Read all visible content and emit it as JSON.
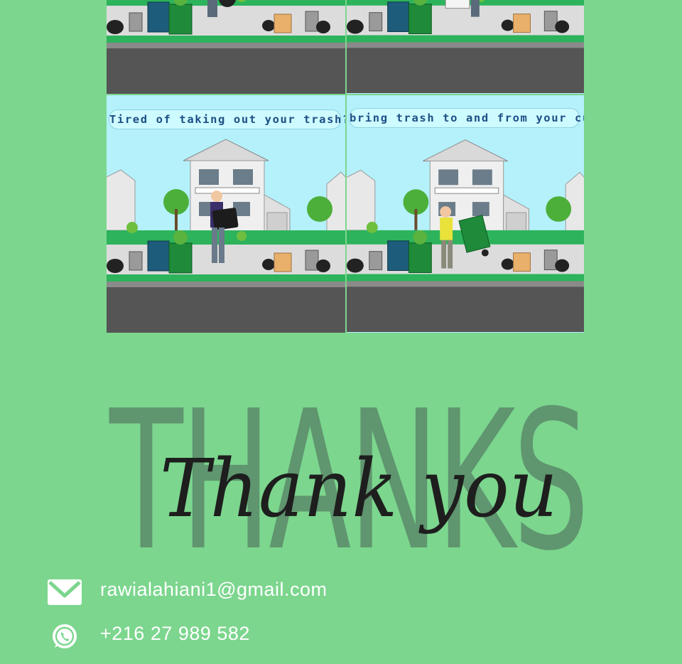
{
  "panels": [
    {
      "caption": "",
      "scene": "delivery"
    },
    {
      "caption": "",
      "scene": "pickup"
    },
    {
      "caption": "Tired of taking out your trash?",
      "scene": "tv-carry"
    },
    {
      "caption": "bring trash to and from your curb",
      "scene": "bin-push"
    }
  ],
  "thanks": {
    "background_word": "THANKS",
    "script_text": "Thank you"
  },
  "contact": {
    "email": "rawialahiani1@gmail.com",
    "phone": "+216 27 989 582",
    "email_icon": "envelope-icon",
    "phone_icon": "whatsapp-icon"
  },
  "colors": {
    "background": "#7cd68e",
    "sky": "#b4f1fb",
    "road": "#555555",
    "grass": "#2db35b",
    "thanks_word": "#5a8a6a",
    "script": "#1e1e1e"
  }
}
